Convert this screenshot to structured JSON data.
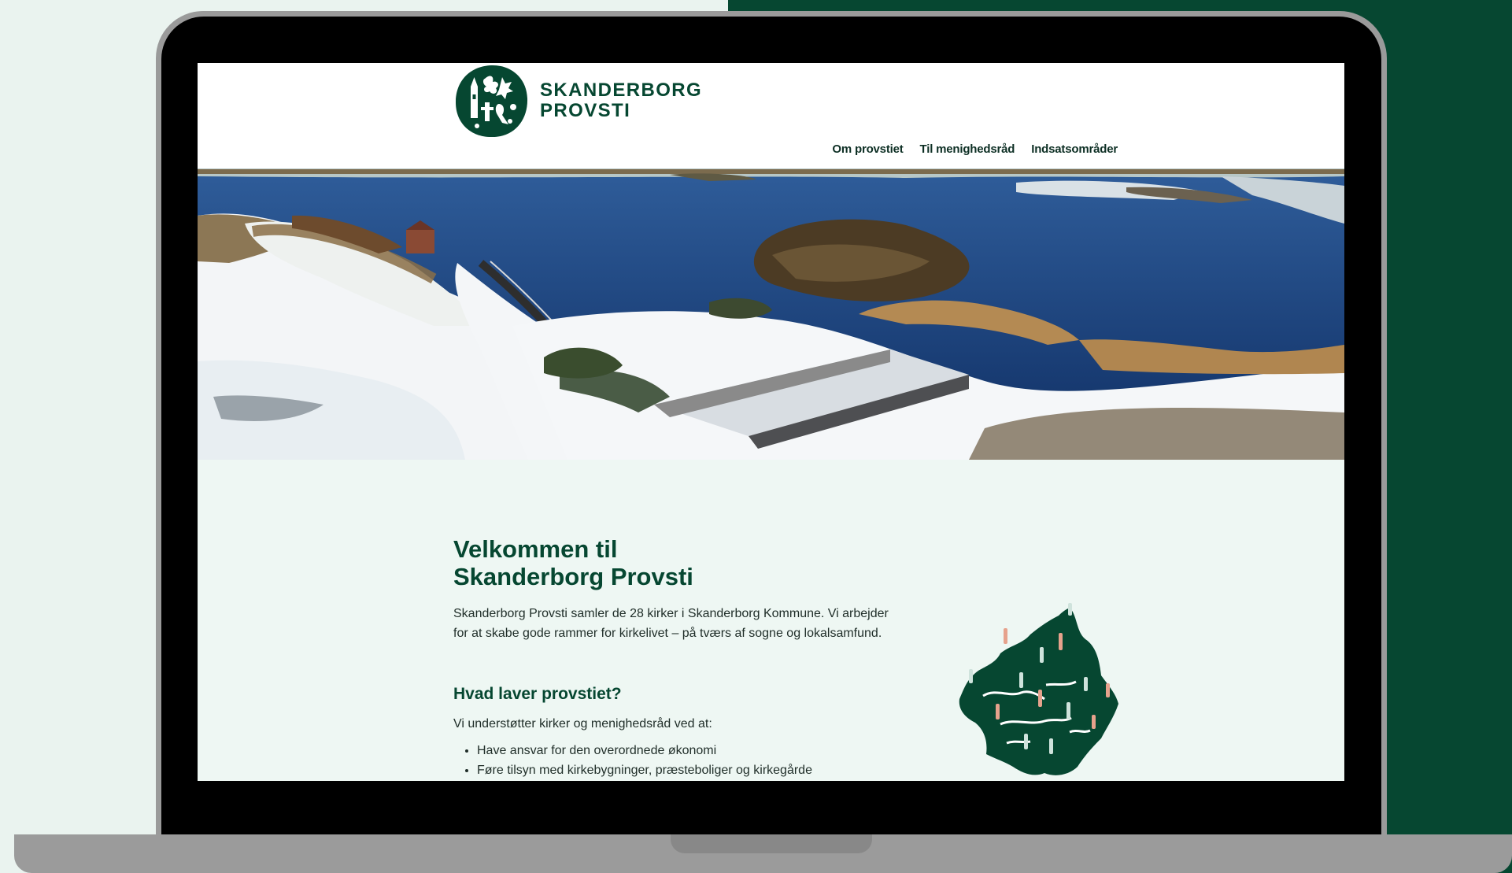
{
  "site": {
    "logo": {
      "line1": "SKANDERBORG",
      "line2": "PROVSTI",
      "icon": "church-emblem-icon"
    },
    "nav": [
      {
        "label": "Om provstiet"
      },
      {
        "label": "Til menighedsråd"
      },
      {
        "label": "Indsatsområder"
      }
    ]
  },
  "hero": {
    "image": "aerial-winter-lake-photo"
  },
  "content": {
    "welcome_line1": "Velkommen til",
    "welcome_line2": "Skanderborg Provsti",
    "intro": "Skanderborg Provsti samler de 28 kirker i Skanderborg Kommune. Vi arbejder for at skabe gode rammer for kirkelivet – på tværs af sogne og lokalsamfund.",
    "subheading": "Hvad laver provstiet?",
    "support_lead": "Vi understøtter kirker og menighedsråd ved at:",
    "tasks": [
      "Have ansvar for den overordnede økonomi",
      "Føre tilsyn med kirkebygninger, præsteboliger og kirkegårde"
    ],
    "map_icon": "municipality-map-icon"
  },
  "colors": {
    "brand_green": "#064731",
    "page_bg": "#eaf3ef",
    "content_bg": "#eef7f3"
  }
}
